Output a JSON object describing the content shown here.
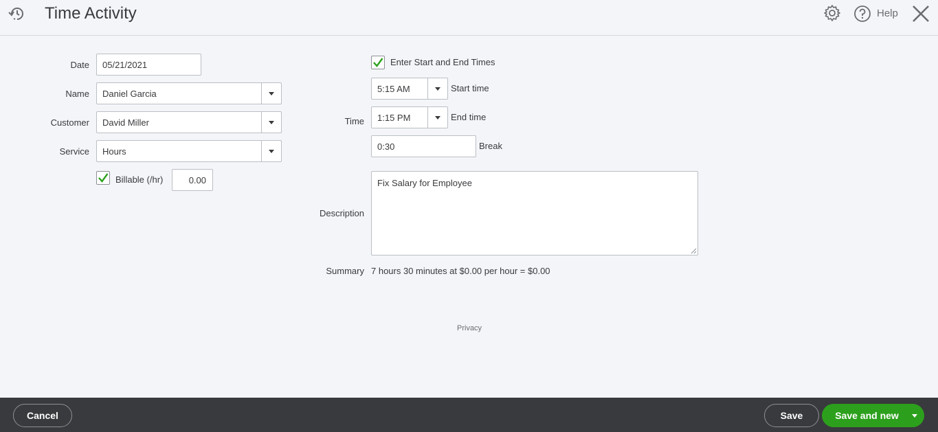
{
  "header": {
    "title": "Time Activity",
    "help_label": "Help",
    "icons": [
      "recent-history-icon",
      "gear-icon",
      "help-circle-icon",
      "close-icon"
    ]
  },
  "form": {
    "date": {
      "label": "Date",
      "value": "05/21/2021"
    },
    "name": {
      "label": "Name",
      "value": "Daniel Garcia"
    },
    "customer": {
      "label": "Customer",
      "value": "David Miller"
    },
    "service": {
      "label": "Service",
      "value": "Hours"
    },
    "billable": {
      "label": "Billable (/hr)",
      "checked": true,
      "rate": "0.00"
    },
    "start_end": {
      "label": "Enter Start and End Times",
      "checked": true
    },
    "time_label": "Time",
    "start_time": {
      "value": "5:15 AM",
      "label": "Start time"
    },
    "end_time": {
      "value": "1:15 PM",
      "label": "End time"
    },
    "break": {
      "value": "0:30",
      "label": "Break"
    },
    "description": {
      "label": "Description",
      "value": "Fix Salary for Employee"
    },
    "summary": {
      "label": "Summary",
      "value": "7 hours 30 minutes at $0.00 per hour = $0.00"
    }
  },
  "privacy_link": "Privacy",
  "footer": {
    "cancel_label": "Cancel",
    "save_label": "Save",
    "save_new_label": "Save and new"
  },
  "colors": {
    "accent_green": "#2ca01c",
    "footer_bg": "#393a3d",
    "page_bg": "#f4f5f8"
  }
}
